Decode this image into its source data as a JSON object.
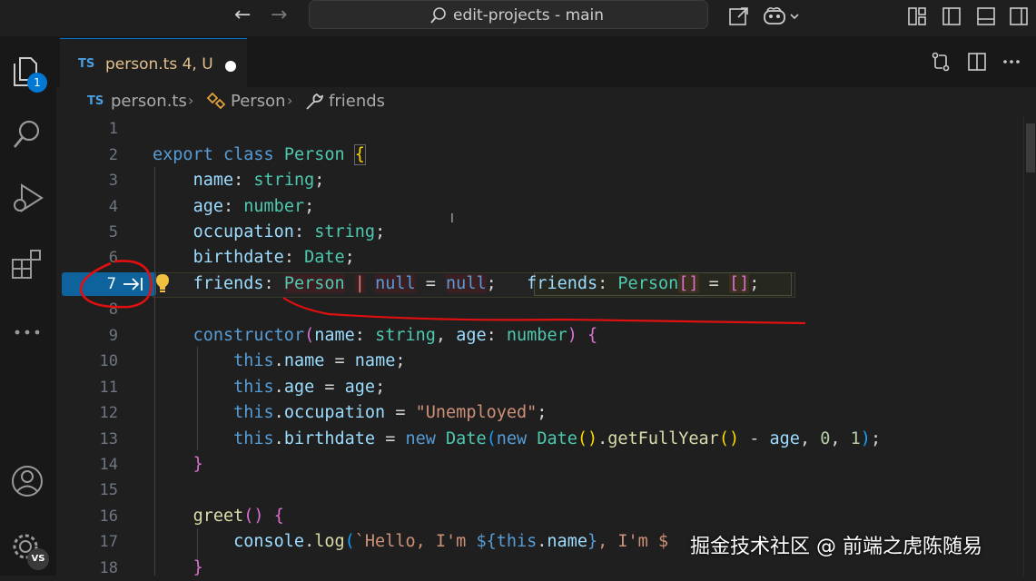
{
  "window": {
    "command_center_text": "edit-projects - main"
  },
  "activity_bar": {
    "explorer_badge": "1",
    "account_badge": "VS"
  },
  "tab": {
    "lang_icon": "TS",
    "label": "person.ts 4, U"
  },
  "breadcrumb": {
    "lang_icon": "TS",
    "file": "person.ts",
    "class": "Person",
    "member": "friends"
  },
  "editor": {
    "line_numbers": [
      "1",
      "2",
      "3",
      "4",
      "5",
      "6",
      "7",
      "8",
      "9",
      "10",
      "11",
      "12",
      "13",
      "14",
      "15",
      "16",
      "17",
      "18"
    ],
    "current_line": "7"
  },
  "watermark": "掘金技术社区 @ 前端之虎陈随易",
  "colors": {
    "accent": "#0078d4",
    "annotation": "#e01010"
  }
}
